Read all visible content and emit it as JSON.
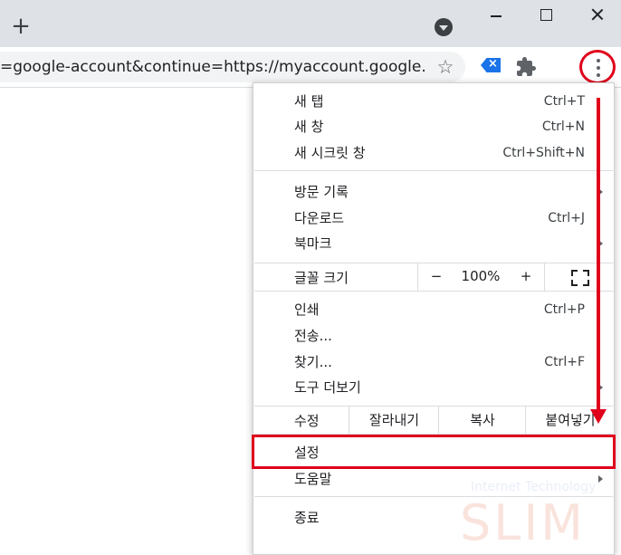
{
  "toolbar": {
    "new_tab": "+",
    "url": "=google-account&continue=https://myaccount.google.co...",
    "star": "☆"
  },
  "extension": {
    "letter": "×"
  },
  "menu": {
    "new_tab": {
      "label": "새 탭",
      "shortcut": "Ctrl+T"
    },
    "new_window": {
      "label": "새 창",
      "shortcut": "Ctrl+N"
    },
    "incognito": {
      "label": "새 시크릿 창",
      "shortcut": "Ctrl+Shift+N"
    },
    "history": {
      "label": "방문 기록"
    },
    "downloads": {
      "label": "다운로드",
      "shortcut": "Ctrl+J"
    },
    "bookmarks": {
      "label": "북마크"
    },
    "zoom": {
      "label": "글꼴 크기",
      "minus": "−",
      "value": "100%",
      "plus": "+"
    },
    "print": {
      "label": "인쇄",
      "shortcut": "Ctrl+P"
    },
    "cast": {
      "label": "전송..."
    },
    "find": {
      "label": "찾기...",
      "shortcut": "Ctrl+F"
    },
    "more_tools": {
      "label": "도구 더보기"
    },
    "edit": {
      "label": "수정",
      "cut": "잘라내기",
      "copy": "복사",
      "paste": "붙여넣기"
    },
    "settings": {
      "label": "설정"
    },
    "help": {
      "label": "도움말"
    },
    "exit": {
      "label": "종료"
    }
  },
  "watermark": {
    "tagline": "Internet Technology",
    "brand": "SLIM"
  },
  "colors": {
    "highlight": "#e0001b",
    "titlebar": "#dee1e6",
    "omnibox": "#f1f3f4"
  }
}
